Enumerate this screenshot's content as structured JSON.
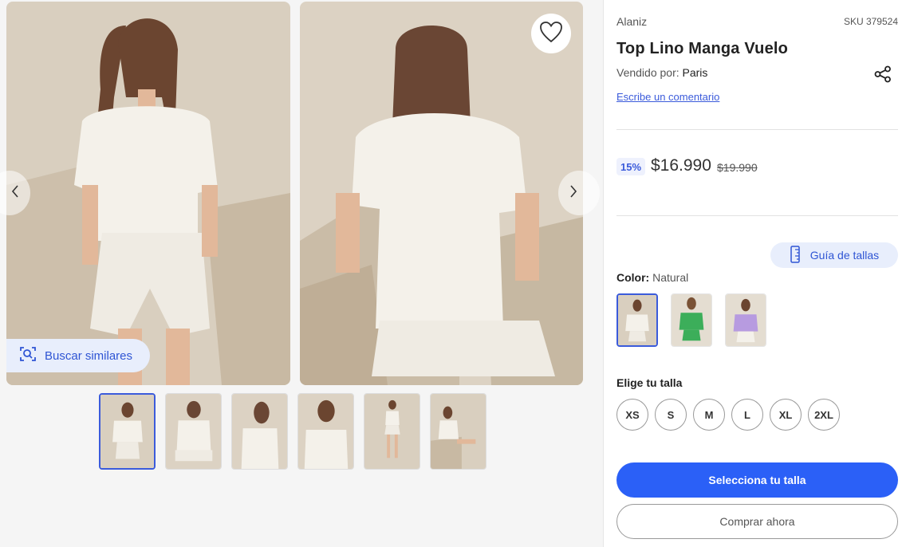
{
  "gallery": {
    "similar_label": "Buscar similares",
    "thumbnail_count": 6,
    "active_thumbnail": 1
  },
  "product": {
    "brand": "Alaniz",
    "sku": "SKU 379524",
    "title": "Top Lino Manga Vuelo",
    "seller_prefix": "Vendido por:",
    "seller_name": "Paris",
    "review_link": "Escribe un comentario"
  },
  "pricing": {
    "discount": "15%",
    "price": "$16.990",
    "old_price": "$19.990"
  },
  "size_guide": {
    "label": "Guía de tallas"
  },
  "color": {
    "label": "Color:",
    "selected": "Natural",
    "options": [
      "Natural",
      "Verde",
      "Lila"
    ],
    "swatch_colors": [
      "#f4f1ea",
      "#3cae5a",
      "#b79be0"
    ]
  },
  "sizes": {
    "label": "Elige tu talla",
    "options": [
      "XS",
      "S",
      "M",
      "L",
      "XL",
      "2XL"
    ]
  },
  "actions": {
    "primary": "Selecciona tu talla",
    "secondary": "Comprar ahora"
  },
  "colors": {
    "accent": "#2b60f7",
    "link": "#3b5bdb",
    "chip_bg": "#e8eefc"
  }
}
